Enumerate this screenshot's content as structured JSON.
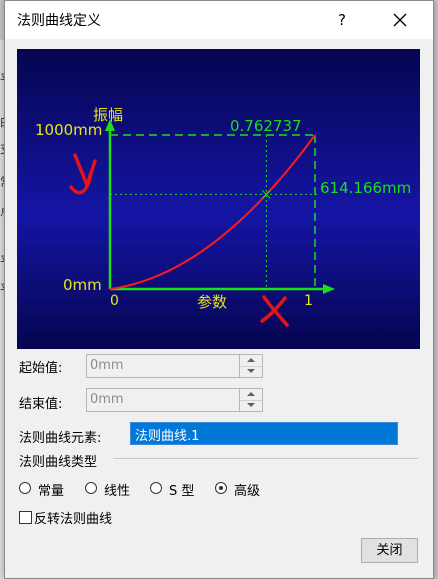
{
  "window": {
    "title": "法则曲线定义",
    "help_label": "?"
  },
  "background_labels": [
    "平",
    "曲",
    "支",
    "常",
    "点",
    "平",
    "平"
  ],
  "chart": {
    "y_axis_label": "振幅",
    "y_max_label": "1000mm",
    "y_min_label": "0mm",
    "x_min_label": "0",
    "x_max_label": "1",
    "x_axis_label": "参数",
    "point_param_label": "0.762737",
    "point_value_label": "614.166mm",
    "point_param": 0.762737,
    "point_value": 614.166,
    "y_range": [
      0,
      1000
    ],
    "x_range": [
      0,
      1
    ],
    "colors": {
      "background": "#0a0a6e",
      "axes": "#19e019",
      "curve": "#ff1a1a",
      "text": "#e6e619",
      "annotation": "#e61414"
    },
    "annotations": {
      "y_mark": "y",
      "x_mark": "x"
    }
  },
  "form": {
    "start_label": "起始值:",
    "start_value": "0mm",
    "end_label": "结束值:",
    "end_value": "0mm",
    "element_label": "法则曲线元素:",
    "element_value": "法则曲线.1",
    "type_group_label": "法则曲线类型",
    "types": [
      {
        "label": "常量",
        "selected": false
      },
      {
        "label": "线性",
        "selected": false
      },
      {
        "label": "S 型",
        "selected": false
      },
      {
        "label": "高级",
        "selected": true
      }
    ],
    "invert_label": "反转法则曲线",
    "invert_checked": false,
    "close_label": "关闭"
  }
}
